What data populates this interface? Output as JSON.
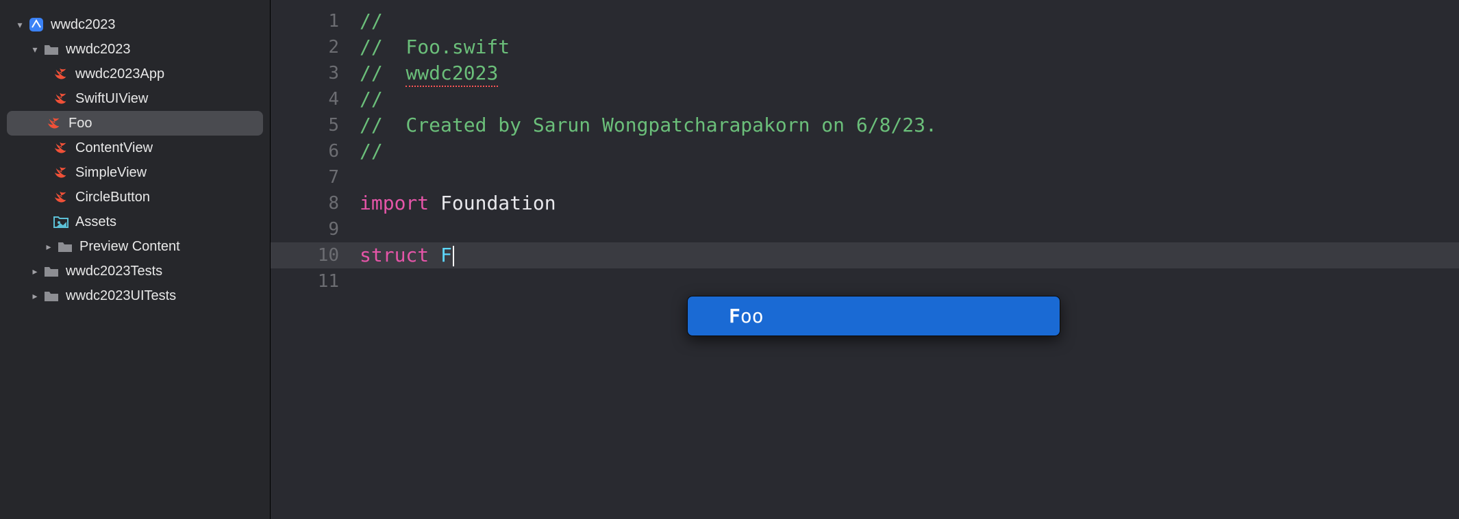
{
  "sidebar": {
    "project": {
      "name": "wwdc2023",
      "expanded": true
    },
    "groups": [
      {
        "name": "wwdc2023",
        "expanded": true,
        "type": "folder",
        "children": [
          {
            "name": "wwdc2023App",
            "type": "swift",
            "selected": false
          },
          {
            "name": "SwiftUIView",
            "type": "swift",
            "selected": false
          },
          {
            "name": "Foo",
            "type": "swift",
            "selected": true
          },
          {
            "name": "ContentView",
            "type": "swift",
            "selected": false
          },
          {
            "name": "SimpleView",
            "type": "swift",
            "selected": false
          },
          {
            "name": "CircleButton",
            "type": "swift",
            "selected": false
          },
          {
            "name": "Assets",
            "type": "assets",
            "selected": false
          },
          {
            "name": "Preview Content",
            "type": "folder",
            "expanded": false
          }
        ]
      },
      {
        "name": "wwdc2023Tests",
        "type": "folder",
        "expanded": false
      },
      {
        "name": "wwdc2023UITests",
        "type": "folder",
        "expanded": false
      }
    ]
  },
  "editor": {
    "lines": [
      {
        "num": "1",
        "segments": [
          {
            "text": "//",
            "cls": "comment"
          }
        ]
      },
      {
        "num": "2",
        "segments": [
          {
            "text": "//  Foo.swift",
            "cls": "comment"
          }
        ]
      },
      {
        "num": "3",
        "segments": [
          {
            "text": "//  ",
            "cls": "comment"
          },
          {
            "text": "wwdc2023",
            "cls": "comment underline-squiggle"
          }
        ]
      },
      {
        "num": "4",
        "segments": [
          {
            "text": "//",
            "cls": "comment"
          }
        ]
      },
      {
        "num": "5",
        "segments": [
          {
            "text": "//  Created by Sarun Wongpatcharapakorn on 6/8/23.",
            "cls": "comment"
          }
        ]
      },
      {
        "num": "6",
        "segments": [
          {
            "text": "//",
            "cls": "comment"
          }
        ]
      },
      {
        "num": "7",
        "segments": []
      },
      {
        "num": "8",
        "segments": [
          {
            "text": "import",
            "cls": "keyword"
          },
          {
            "text": " Foundation",
            "cls": "plain"
          }
        ]
      },
      {
        "num": "9",
        "segments": []
      },
      {
        "num": "10",
        "current": true,
        "segments": [
          {
            "text": "struct",
            "cls": "keyword"
          },
          {
            "text": " ",
            "cls": "plain"
          },
          {
            "text": "F",
            "cls": "typed"
          }
        ],
        "cursor": true
      },
      {
        "num": "11",
        "segments": []
      }
    ],
    "autocomplete": {
      "visible": true,
      "items": [
        {
          "bold": "F",
          "rest": "oo"
        }
      ]
    }
  }
}
